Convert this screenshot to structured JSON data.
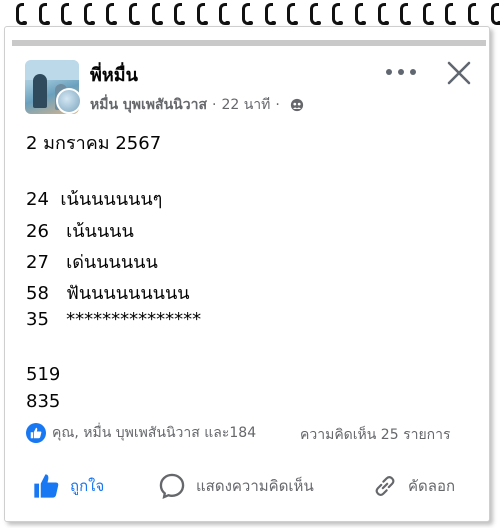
{
  "post": {
    "author": "พี่หมื่น",
    "group_member": "หมื่น บุพเพสันนิวาส",
    "time": "22 นาที",
    "date_line": "2 มกราคม 2567",
    "lines": [
      {
        "num": "24",
        "text": "เน้นนนนนนๆ"
      },
      {
        "num": "26",
        "text": "เน้นนนน"
      },
      {
        "num": "27",
        "text": "เด่นนนนนน"
      },
      {
        "num": "58",
        "text": "ฟันนนนนนนนน"
      },
      {
        "num": "35",
        "text": "***************"
      }
    ],
    "extra_numbers": [
      "519",
      "835"
    ]
  },
  "reactions": {
    "text": "คุณ, หมื่น บุพเพสันนิวาส และ184",
    "comments": "ความคิดเห็น 25 รายการ"
  },
  "actions": {
    "like": "ถูกใจ",
    "comment": "แสดงความคิดเห็น",
    "share": "คัดลอก"
  },
  "colors": {
    "accent": "#1877f2",
    "secondary_text": "#65676b",
    "primary_text": "#050505"
  }
}
